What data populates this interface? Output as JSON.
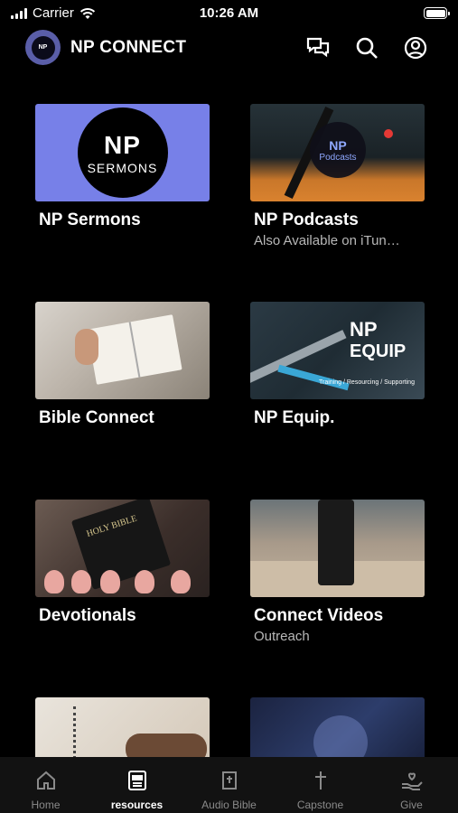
{
  "status_bar": {
    "carrier": "Carrier",
    "time": "10:26 AM"
  },
  "header": {
    "logo_text": "NP",
    "title": "NP CONNECT"
  },
  "tiles": [
    {
      "title": "NP Sermons",
      "subtitle": "",
      "thumb_text": {
        "np": "NP",
        "word": "SERMONS"
      }
    },
    {
      "title": "NP Podcasts",
      "subtitle": "Also Available on iTun…",
      "thumb_text": {
        "np": "NP",
        "word": "Podcasts"
      }
    },
    {
      "title": "Bible Connect",
      "subtitle": ""
    },
    {
      "title": "NP Equip.",
      "subtitle": "",
      "thumb_text": {
        "np": "NP",
        "word": "EQUIP",
        "tagline": "Training / Resourcing / Supporting"
      }
    },
    {
      "title": "Devotionals",
      "subtitle": "",
      "thumb_text": {
        "book": "HOLY BIBLE"
      }
    },
    {
      "title": "Connect Videos",
      "subtitle": "Outreach"
    },
    {
      "title": "",
      "subtitle": ""
    },
    {
      "title": "",
      "subtitle": ""
    }
  ],
  "tabs": [
    {
      "label": "Home",
      "icon": "home-icon",
      "active": false
    },
    {
      "label": "resources",
      "icon": "resources-icon",
      "active": true
    },
    {
      "label": "Audio Bible",
      "icon": "bible-icon",
      "active": false
    },
    {
      "label": "Capstone",
      "icon": "cross-icon",
      "active": false
    },
    {
      "label": "Give",
      "icon": "give-hand-heart-icon",
      "active": false
    }
  ],
  "colors": {
    "accent_blue": "#4a7be6",
    "sermons_bg": "#7780e8",
    "tab_inactive": "#8a8a8a"
  }
}
